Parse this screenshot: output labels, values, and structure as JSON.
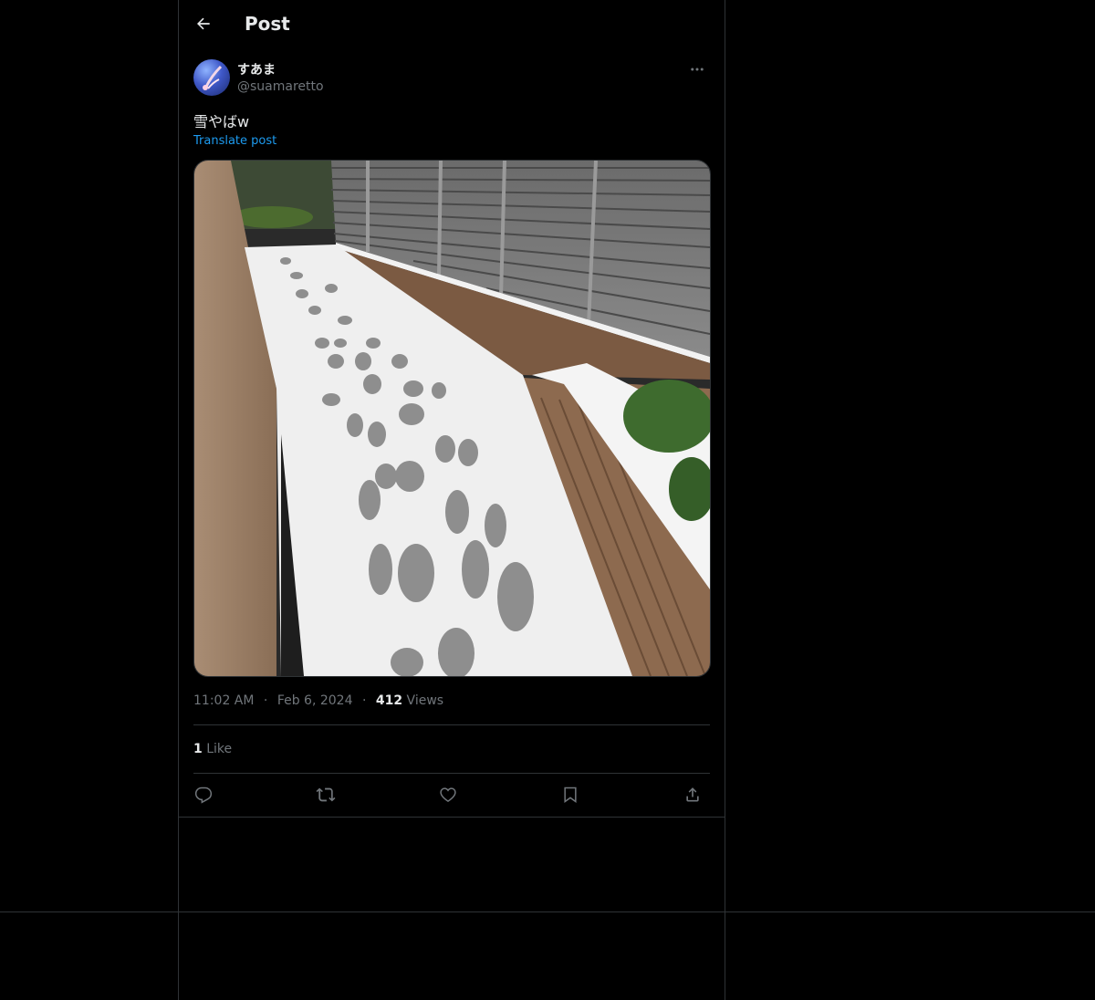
{
  "header": {
    "title": "Post"
  },
  "author": {
    "display_name": "すあま",
    "handle": "@suamaretto"
  },
  "post": {
    "text": "雪やばw",
    "translate_label": "Translate post",
    "time": "11:02 AM",
    "date": "Feb 6, 2024",
    "views_count": "412",
    "views_label": "Views",
    "likes_count": "1",
    "likes_label": "Like"
  },
  "meta_separator": "·",
  "icons": {
    "back": "back-arrow-icon",
    "more": "more-icon",
    "reply": "reply-icon",
    "repost": "repost-icon",
    "like": "like-icon",
    "bookmark": "bookmark-icon",
    "share": "share-icon"
  },
  "colors": {
    "background": "#000000",
    "text": "#e7e9ea",
    "muted": "#71767b",
    "link": "#1d9bf0",
    "border": "#2f3336"
  }
}
